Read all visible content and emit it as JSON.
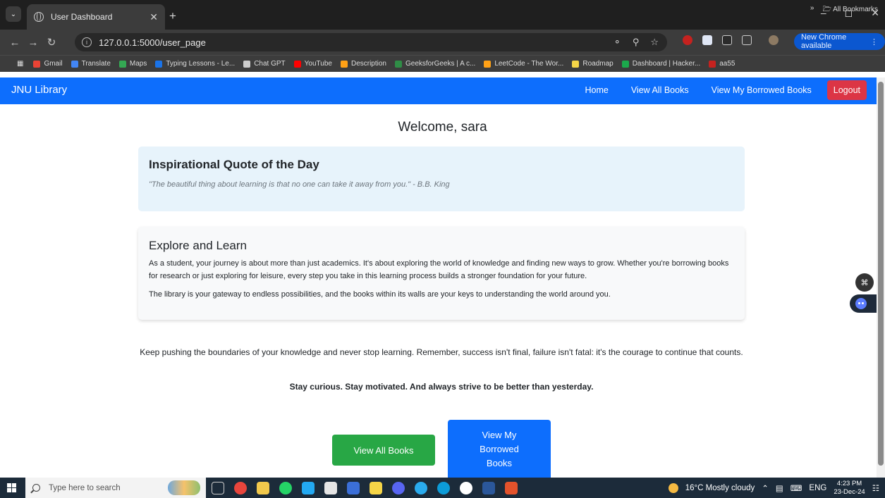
{
  "browser": {
    "tab_title": "User Dashboard",
    "url": "127.0.0.1:5000/user_page",
    "new_chrome": "New Chrome available",
    "bookmarks": [
      {
        "label": "Gmail",
        "color": "#ea4335"
      },
      {
        "label": "Translate",
        "color": "#4285f4"
      },
      {
        "label": "Maps",
        "color": "#34a853"
      },
      {
        "label": "Typing Lessons - Le...",
        "color": "#1a73e8"
      },
      {
        "label": "Chat GPT",
        "color": "#cccccc"
      },
      {
        "label": "YouTube",
        "color": "#ff0000"
      },
      {
        "label": "Description",
        "color": "#ffa116"
      },
      {
        "label": "GeeksforGeeks | A c...",
        "color": "#2f8d46"
      },
      {
        "label": "LeetCode - The Wor...",
        "color": "#ffa116"
      },
      {
        "label": "Roadmap",
        "color": "#f5d547"
      },
      {
        "label": "Dashboard | Hacker...",
        "color": "#1ba94c"
      },
      {
        "label": "aa55",
        "color": "#c5221f"
      }
    ],
    "all_bookmarks": "All Bookmarks"
  },
  "navbar": {
    "brand": "JNU Library",
    "home": "Home",
    "view_all": "View All Books",
    "view_borrowed": "View My Borrowed Books",
    "logout": "Logout"
  },
  "main": {
    "welcome": "Welcome, sara",
    "quote": {
      "title": "Inspirational Quote of the Day",
      "text": "\"The beautiful thing about learning is that no one can take it away from you.\" - B.B. King"
    },
    "explore": {
      "title": "Explore and Learn",
      "p1": "As a student, your journey is about more than just academics. It's about exploring the world of knowledge and finding new ways to grow. Whether you're borrowing books for research or just exploring for leisure, every step you take in this learning process builds a stronger foundation for your future.",
      "p2": "The library is your gateway to endless possibilities, and the books within its walls are your keys to understanding the world around you."
    },
    "motivate": "Keep pushing the boundaries of your knowledge and never stop learning. Remember, success isn't final, failure isn't fatal: it's the courage to continue that counts.",
    "motivate_bold": "Stay curious. Stay motivated. And always strive to be better than yesterday.",
    "btn_all": "View All Books",
    "btn_borrowed": "View My Borrowed Books"
  },
  "taskbar": {
    "search_placeholder": "Type here to search",
    "weather": "16°C  Mostly cloudy",
    "lang": "ENG",
    "time": "4:23 PM",
    "date": "23-Dec-24"
  }
}
